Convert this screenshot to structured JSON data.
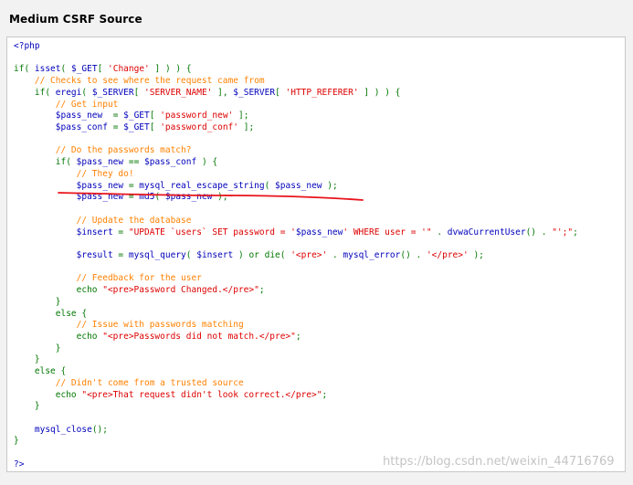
{
  "page": {
    "title": "Medium CSRF Source",
    "watermark": "https://blog.csdn.net/weixin_44716769"
  },
  "code": {
    "lines": [
      [
        {
          "t": "<?php",
          "c": "tag"
        }
      ],
      [],
      [
        {
          "t": "if( ",
          "c": "kw"
        },
        {
          "t": "isset",
          "c": "var"
        },
        {
          "t": "( ",
          "c": "kw"
        },
        {
          "t": "$_GET",
          "c": "var"
        },
        {
          "t": "[ ",
          "c": "kw"
        },
        {
          "t": "'Change'",
          "c": "str"
        },
        {
          "t": " ] ) ) {",
          "c": "kw"
        }
      ],
      [
        {
          "t": "    // Checks to see where the request came from",
          "c": "cmt"
        }
      ],
      [
        {
          "t": "    if( ",
          "c": "kw"
        },
        {
          "t": "eregi",
          "c": "var"
        },
        {
          "t": "( ",
          "c": "kw"
        },
        {
          "t": "$_SERVER",
          "c": "var"
        },
        {
          "t": "[ ",
          "c": "kw"
        },
        {
          "t": "'SERVER_NAME'",
          "c": "str"
        },
        {
          "t": " ], ",
          "c": "kw"
        },
        {
          "t": "$_SERVER",
          "c": "var"
        },
        {
          "t": "[ ",
          "c": "kw"
        },
        {
          "t": "'HTTP_REFERER'",
          "c": "str"
        },
        {
          "t": " ] ) ) {",
          "c": "kw"
        }
      ],
      [
        {
          "t": "        // Get input",
          "c": "cmt"
        }
      ],
      [
        {
          "t": "        ",
          "c": "kw"
        },
        {
          "t": "$pass_new",
          "c": "var"
        },
        {
          "t": "  = ",
          "c": "kw"
        },
        {
          "t": "$_GET",
          "c": "var"
        },
        {
          "t": "[ ",
          "c": "kw"
        },
        {
          "t": "'password_new'",
          "c": "str"
        },
        {
          "t": " ];",
          "c": "kw"
        }
      ],
      [
        {
          "t": "        ",
          "c": "kw"
        },
        {
          "t": "$pass_conf",
          "c": "var"
        },
        {
          "t": " = ",
          "c": "kw"
        },
        {
          "t": "$_GET",
          "c": "var"
        },
        {
          "t": "[ ",
          "c": "kw"
        },
        {
          "t": "'password_conf'",
          "c": "str"
        },
        {
          "t": " ];",
          "c": "kw"
        }
      ],
      [],
      [
        {
          "t": "        // Do the passwords match?",
          "c": "cmt"
        }
      ],
      [
        {
          "t": "        if( ",
          "c": "kw"
        },
        {
          "t": "$pass_new",
          "c": "var"
        },
        {
          "t": " == ",
          "c": "kw"
        },
        {
          "t": "$pass_conf",
          "c": "var"
        },
        {
          "t": " ) {",
          "c": "kw"
        }
      ],
      [
        {
          "t": "            // They do!",
          "c": "cmt"
        }
      ],
      [
        {
          "t": "            ",
          "c": "kw"
        },
        {
          "t": "$pass_new",
          "c": "var"
        },
        {
          "t": " = ",
          "c": "kw"
        },
        {
          "t": "mysql_real_escape_string",
          "c": "var"
        },
        {
          "t": "( ",
          "c": "kw"
        },
        {
          "t": "$pass_new",
          "c": "var"
        },
        {
          "t": " );",
          "c": "kw"
        }
      ],
      [
        {
          "t": "            ",
          "c": "kw"
        },
        {
          "t": "$pass_new",
          "c": "var"
        },
        {
          "t": " = ",
          "c": "kw"
        },
        {
          "t": "md5",
          "c": "var"
        },
        {
          "t": "( ",
          "c": "kw"
        },
        {
          "t": "$pass_new",
          "c": "var"
        },
        {
          "t": " );",
          "c": "kw"
        }
      ],
      [],
      [
        {
          "t": "            // Update the database",
          "c": "cmt"
        }
      ],
      [
        {
          "t": "            ",
          "c": "kw"
        },
        {
          "t": "$insert",
          "c": "var"
        },
        {
          "t": " = ",
          "c": "kw"
        },
        {
          "t": "\"UPDATE `users` SET password = '",
          "c": "str"
        },
        {
          "t": "$pass_new",
          "c": "var"
        },
        {
          "t": "' WHERE user = '\"",
          "c": "str"
        },
        {
          "t": " . ",
          "c": "kw"
        },
        {
          "t": "dvwaCurrentUser",
          "c": "var"
        },
        {
          "t": "() . ",
          "c": "kw"
        },
        {
          "t": "\"';\"",
          "c": "str"
        },
        {
          "t": ";",
          "c": "kw"
        }
      ],
      [],
      [
        {
          "t": "            ",
          "c": "kw"
        },
        {
          "t": "$result",
          "c": "var"
        },
        {
          "t": " = ",
          "c": "kw"
        },
        {
          "t": "mysql_query",
          "c": "var"
        },
        {
          "t": "( ",
          "c": "kw"
        },
        {
          "t": "$insert",
          "c": "var"
        },
        {
          "t": " ) or die( ",
          "c": "kw"
        },
        {
          "t": "'<pre>'",
          "c": "str"
        },
        {
          "t": " . ",
          "c": "kw"
        },
        {
          "t": "mysql_error",
          "c": "var"
        },
        {
          "t": "() . ",
          "c": "kw"
        },
        {
          "t": "'</pre>'",
          "c": "str"
        },
        {
          "t": " );",
          "c": "kw"
        }
      ],
      [],
      [
        {
          "t": "            // Feedback for the user",
          "c": "cmt"
        }
      ],
      [
        {
          "t": "            echo ",
          "c": "kw"
        },
        {
          "t": "\"<pre>Password Changed.</pre>\"",
          "c": "str"
        },
        {
          "t": ";",
          "c": "kw"
        }
      ],
      [
        {
          "t": "        }",
          "c": "kw"
        }
      ],
      [
        {
          "t": "        else {",
          "c": "kw"
        }
      ],
      [
        {
          "t": "            // Issue with passwords matching",
          "c": "cmt"
        }
      ],
      [
        {
          "t": "            echo ",
          "c": "kw"
        },
        {
          "t": "\"<pre>Passwords did not match.</pre>\"",
          "c": "str"
        },
        {
          "t": ";",
          "c": "kw"
        }
      ],
      [
        {
          "t": "        }",
          "c": "kw"
        }
      ],
      [
        {
          "t": "    }",
          "c": "kw"
        }
      ],
      [
        {
          "t": "    else {",
          "c": "kw"
        }
      ],
      [
        {
          "t": "        // Didn't come from a trusted source",
          "c": "cmt"
        }
      ],
      [
        {
          "t": "        echo ",
          "c": "kw"
        },
        {
          "t": "\"<pre>That request didn't look correct.</pre>\"",
          "c": "str"
        },
        {
          "t": ";",
          "c": "kw"
        }
      ],
      [
        {
          "t": "    }",
          "c": "kw"
        }
      ],
      [],
      [
        {
          "t": "    ",
          "c": "kw"
        },
        {
          "t": "mysql_close",
          "c": "var"
        },
        {
          "t": "();",
          "c": "kw"
        }
      ],
      [
        {
          "t": "}",
          "c": "kw"
        }
      ],
      [],
      [
        {
          "t": "?>",
          "c": "tag"
        }
      ]
    ]
  },
  "colors": {
    "keyword": "#007700",
    "variable": "#0000bb",
    "string": "#dd0000",
    "comment": "#ff8000",
    "annotation_line": "#e8141b"
  }
}
